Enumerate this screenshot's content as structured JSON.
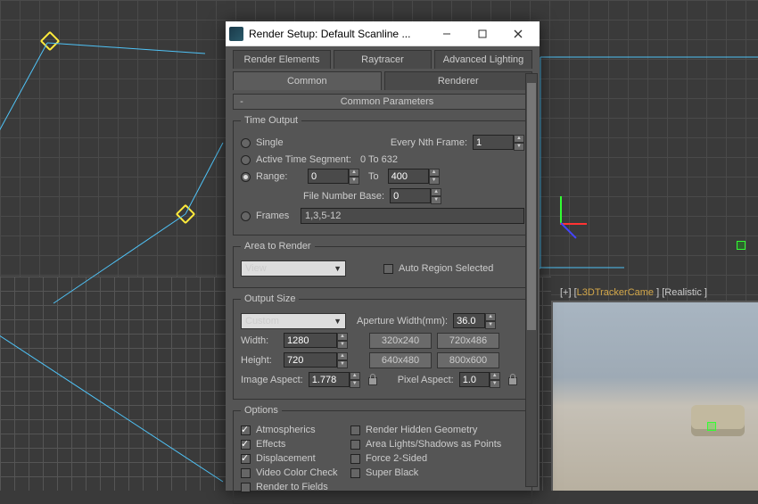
{
  "window": {
    "title": "Render Setup: Default Scanline ..."
  },
  "tabs1": {
    "elements": "Render Elements",
    "raytracer": "Raytracer",
    "advanced": "Advanced Lighting"
  },
  "tabs2": {
    "common": "Common",
    "renderer": "Renderer"
  },
  "section_common": "Common Parameters",
  "time": {
    "legend": "Time Output",
    "single": "Single",
    "every": "Every Nth Frame:",
    "every_val": "1",
    "ats": "Active Time Segment:",
    "ats_val": "0 To 632",
    "range": "Range:",
    "range_from": "0",
    "range_to_lbl": "To",
    "range_to": "400",
    "fnb": "File Number Base:",
    "fnb_val": "0",
    "frames": "Frames",
    "frames_val": "1,3,5-12"
  },
  "area": {
    "legend": "Area to Render",
    "view": "View",
    "auto": "Auto Region Selected"
  },
  "out": {
    "legend": "Output Size",
    "custom": "Custom",
    "aperture": "Aperture Width(mm):",
    "aperture_val": "36.0",
    "width_lbl": "Width:",
    "width": "1280",
    "height_lbl": "Height:",
    "height": "720",
    "p1": "320x240",
    "p2": "720x486",
    "p3": "640x480",
    "p4": "800x600",
    "ia": "Image Aspect:",
    "ia_val": "1.778",
    "pa": "Pixel Aspect:",
    "pa_val": "1.0"
  },
  "opts": {
    "legend": "Options",
    "atmos": "Atmospherics",
    "rhg": "Render Hidden Geometry",
    "fx": "Effects",
    "alsp": "Area Lights/Shadows as Points",
    "disp": "Displacement",
    "f2": "Force 2-Sided",
    "vcc": "Video Color Check",
    "sb": "Super Black",
    "rtf": "Render to Fields"
  },
  "viewport": {
    "prefix": "[+] [",
    "cam": "L3DTrackerCame",
    "suffix": " ] [Realistic ]"
  }
}
